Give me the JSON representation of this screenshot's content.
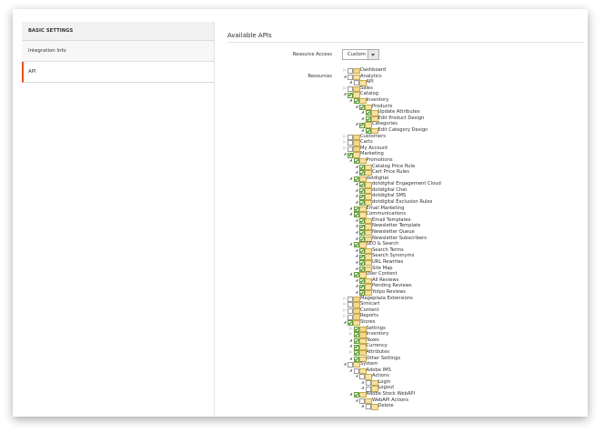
{
  "sidebar": {
    "header": "BASIC SETTINGS",
    "items": [
      {
        "label": "Integration Info",
        "active": false
      },
      {
        "label": "API",
        "active": true
      }
    ]
  },
  "main": {
    "title": "Available APIs",
    "resource_access": {
      "label": "Resource Access",
      "value": "Custom"
    },
    "resources_label": "Resources"
  },
  "accent_color": "#eb5202",
  "tree": [
    {
      "label": "Dashboard",
      "depth": 0,
      "checked": false,
      "toggle": "closed"
    },
    {
      "label": "Analytics",
      "depth": 0,
      "checked": false,
      "toggle": "open"
    },
    {
      "label": "API",
      "depth": 1,
      "checked": false,
      "toggle": "open"
    },
    {
      "label": "Sales",
      "depth": 0,
      "checked": false,
      "toggle": "closed"
    },
    {
      "label": "Catalog",
      "depth": 0,
      "checked": true,
      "toggle": "open"
    },
    {
      "label": "Inventory",
      "depth": 1,
      "checked": true,
      "toggle": "open"
    },
    {
      "label": "Products",
      "depth": 2,
      "checked": true,
      "toggle": "open"
    },
    {
      "label": "Update Attributes",
      "depth": 3,
      "checked": true,
      "toggle": "open"
    },
    {
      "label": "Edit Product Design",
      "depth": 3,
      "checked": true,
      "toggle": "open"
    },
    {
      "label": "Categories",
      "depth": 2,
      "checked": true,
      "toggle": "open"
    },
    {
      "label": "Edit Category Design",
      "depth": 3,
      "checked": true,
      "toggle": "open"
    },
    {
      "label": "Customers",
      "depth": 0,
      "checked": false,
      "toggle": "closed"
    },
    {
      "label": "Carts",
      "depth": 0,
      "checked": false,
      "toggle": "closed"
    },
    {
      "label": "My Account",
      "depth": 0,
      "checked": false,
      "toggle": "closed"
    },
    {
      "label": "Marketing",
      "depth": 0,
      "checked": true,
      "toggle": "open"
    },
    {
      "label": "Promotions",
      "depth": 1,
      "checked": true,
      "toggle": "open"
    },
    {
      "label": "Catalog Price Rule",
      "depth": 2,
      "checked": true,
      "toggle": "open"
    },
    {
      "label": "Cart Price Rules",
      "depth": 2,
      "checked": true,
      "toggle": "open"
    },
    {
      "label": "dotdigital",
      "depth": 1,
      "checked": true,
      "toggle": "open"
    },
    {
      "label": "dotdigital Engagement Cloud",
      "depth": 2,
      "checked": true,
      "toggle": "open"
    },
    {
      "label": "dotdigital Chat",
      "depth": 2,
      "checked": true,
      "toggle": "open"
    },
    {
      "label": "dotdigital SMS",
      "depth": 2,
      "checked": true,
      "toggle": "open"
    },
    {
      "label": "dotdigital Exclusion Rules",
      "depth": 2,
      "checked": true,
      "toggle": "open"
    },
    {
      "label": "Email Marketing",
      "depth": 1,
      "checked": true,
      "toggle": "open"
    },
    {
      "label": "Communications",
      "depth": 1,
      "checked": true,
      "toggle": "open"
    },
    {
      "label": "Email Templates",
      "depth": 2,
      "checked": true,
      "toggle": "open"
    },
    {
      "label": "Newsletter Template",
      "depth": 2,
      "checked": true,
      "toggle": "open"
    },
    {
      "label": "Newsletter Queue",
      "depth": 2,
      "checked": true,
      "toggle": "open"
    },
    {
      "label": "Newsletter Subscribers",
      "depth": 2,
      "checked": true,
      "toggle": "open"
    },
    {
      "label": "SEO & Search",
      "depth": 1,
      "checked": true,
      "toggle": "open"
    },
    {
      "label": "Search Terms",
      "depth": 2,
      "checked": true,
      "toggle": "open"
    },
    {
      "label": "Search Synonyms",
      "depth": 2,
      "checked": true,
      "toggle": "open"
    },
    {
      "label": "URL Rewrites",
      "depth": 2,
      "checked": true,
      "toggle": "open"
    },
    {
      "label": "Site Map",
      "depth": 2,
      "checked": true,
      "toggle": "open"
    },
    {
      "label": "User Content",
      "depth": 1,
      "checked": true,
      "toggle": "open"
    },
    {
      "label": "All Reviews",
      "depth": 2,
      "checked": true,
      "toggle": "open"
    },
    {
      "label": "Pending Reviews",
      "depth": 2,
      "checked": true,
      "toggle": "open"
    },
    {
      "label": "Yotpo Reviews",
      "depth": 2,
      "checked": true,
      "toggle": "open"
    },
    {
      "label": "Mageplaza Extensions",
      "depth": 0,
      "checked": false,
      "toggle": "closed"
    },
    {
      "label": "Simicart",
      "depth": 0,
      "checked": false,
      "toggle": "closed"
    },
    {
      "label": "Content",
      "depth": 0,
      "checked": false,
      "toggle": "closed"
    },
    {
      "label": "Reports",
      "depth": 0,
      "checked": false,
      "toggle": "closed"
    },
    {
      "label": "Stores",
      "depth": 0,
      "checked": true,
      "toggle": "open"
    },
    {
      "label": "Settings",
      "depth": 1,
      "checked": true,
      "toggle": "closed"
    },
    {
      "label": "Inventory",
      "depth": 1,
      "checked": true,
      "toggle": "closed"
    },
    {
      "label": "Taxes",
      "depth": 1,
      "checked": true,
      "toggle": "open"
    },
    {
      "label": "Currency",
      "depth": 1,
      "checked": true,
      "toggle": "open"
    },
    {
      "label": "Attributes",
      "depth": 1,
      "checked": true,
      "toggle": "closed"
    },
    {
      "label": "Other Settings",
      "depth": 1,
      "checked": true,
      "toggle": "open"
    },
    {
      "label": "System",
      "depth": 0,
      "checked": false,
      "toggle": "open"
    },
    {
      "label": "Adobe IMS",
      "depth": 1,
      "checked": false,
      "toggle": "open"
    },
    {
      "label": "Actions",
      "depth": 2,
      "checked": false,
      "toggle": "open"
    },
    {
      "label": "Login",
      "depth": 3,
      "checked": false,
      "toggle": "open"
    },
    {
      "label": "Logout",
      "depth": 3,
      "checked": false,
      "toggle": "open"
    },
    {
      "label": "Adobe Stock WebAPI",
      "depth": 1,
      "checked": true,
      "toggle": "open"
    },
    {
      "label": "WebAPI Actions",
      "depth": 2,
      "checked": false,
      "toggle": "open"
    },
    {
      "label": "Delete",
      "depth": 3,
      "checked": false,
      "toggle": "open"
    }
  ]
}
